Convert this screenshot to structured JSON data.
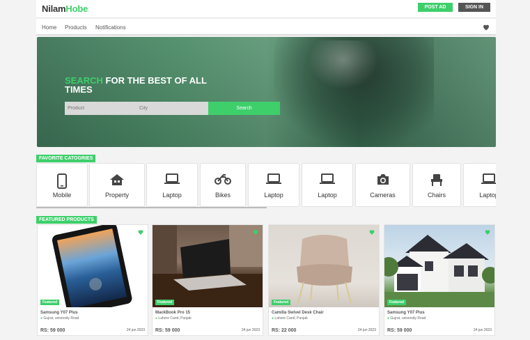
{
  "header": {
    "logo_part1": "Nilam",
    "logo_part2": "Hobe",
    "post_ad": "POST AD",
    "sign_in": "SIGN IN"
  },
  "nav": {
    "items": [
      "Home",
      "Products",
      "Notifications"
    ],
    "wishlist_icon": "heart-icon"
  },
  "hero": {
    "title_accent": "SEARCH",
    "title_rest": " FOR THE BEST OF ALL TIMES",
    "product_placeholder": "Product",
    "city_placeholder": "City",
    "search_label": "Search"
  },
  "categories": {
    "heading": "FAVORITE CATOGRIES",
    "items": [
      {
        "label": "Mobile",
        "icon": "mobile-icon"
      },
      {
        "label": "Property",
        "icon": "house-icon"
      },
      {
        "label": "Laptop",
        "icon": "laptop-icon"
      },
      {
        "label": "Bikes",
        "icon": "motorcycle-icon"
      },
      {
        "label": "Laptop",
        "icon": "laptop-icon"
      },
      {
        "label": "Laptop",
        "icon": "laptop-icon"
      },
      {
        "label": "Cameras",
        "icon": "camera-icon"
      },
      {
        "label": "Chairs",
        "icon": "chair-icon"
      },
      {
        "label": "Laptop",
        "icon": "laptop-icon"
      }
    ]
  },
  "featured": {
    "heading": "FEATURED PRODUCTS",
    "products": [
      {
        "badge": "Featured",
        "title": "Samsung Y07 Plus",
        "location": "Gujrat, university Road",
        "price": "RS: 59 000",
        "date": "24 jun 2023",
        "image": "tablet-image"
      },
      {
        "badge": "Featured",
        "title": "MackBook Pro 15",
        "location": "Lahore Cantt, Punjab",
        "price": "RS: 59 000",
        "date": "24 jun 2023",
        "image": "laptop-image"
      },
      {
        "badge": "Featured",
        "title": "Camilla Swivel Desk Chair",
        "location": "Lahore Cantt, Punjab",
        "price": "RS: 22 000",
        "date": "24 jun 2023",
        "image": "chair-image"
      },
      {
        "badge": "Featured",
        "title": "Samsung Y07 Plus",
        "location": "Gujrat, university Road",
        "price": "RS: 59 000",
        "date": "24 jun 2023",
        "image": "house-image"
      }
    ]
  },
  "colors": {
    "accent": "#3ecf6b",
    "dark_button": "#555555"
  }
}
